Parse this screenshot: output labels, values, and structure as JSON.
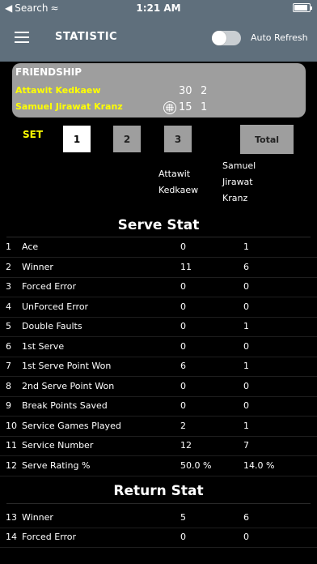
{
  "status": {
    "carrier": "Search",
    "time": "1:21 AM"
  },
  "nav": {
    "title": "STATISTIC",
    "auto_refresh_label": "Auto Refresh",
    "auto_refresh_on": false
  },
  "match": {
    "title": "FRIENDSHIP",
    "players": [
      {
        "name": "Attawit Kedkaew",
        "points": "30",
        "games": "2"
      },
      {
        "name": "Samuel Jirawat Kranz",
        "points": "15",
        "games": "1"
      }
    ]
  },
  "sets": {
    "label": "SET",
    "buttons": [
      "1",
      "2",
      "3"
    ],
    "total": "Total",
    "selected": "1"
  },
  "columns": {
    "player1": [
      "Attawit",
      "Kedkaew"
    ],
    "player2": [
      "Samuel",
      "Jirawat",
      "Kranz"
    ]
  },
  "serve_stat": {
    "title": "Serve Stat",
    "rows": [
      {
        "num": "1",
        "label": "Ace",
        "p1": "0",
        "p2": "1"
      },
      {
        "num": "2",
        "label": "Winner",
        "p1": "11",
        "p2": "6"
      },
      {
        "num": "3",
        "label": "Forced Error",
        "p1": "0",
        "p2": "0"
      },
      {
        "num": "4",
        "label": "UnForced Error",
        "p1": "0",
        "p2": "0"
      },
      {
        "num": "5",
        "label": "Double Faults",
        "p1": "0",
        "p2": "1"
      },
      {
        "num": "6",
        "label": "1st Serve",
        "p1": "0",
        "p2": "0"
      },
      {
        "num": "7",
        "label": "1st Serve Point Won",
        "p1": "6",
        "p2": "1"
      },
      {
        "num": "8",
        "label": "2nd Serve Point Won",
        "p1": "0",
        "p2": "0"
      },
      {
        "num": "9",
        "label": "Break Points Saved",
        "p1": "0",
        "p2": "0"
      },
      {
        "num": "10",
        "label": "Service Games Played",
        "p1": "2",
        "p2": "1"
      },
      {
        "num": "11",
        "label": "Service Number",
        "p1": "12",
        "p2": "7"
      },
      {
        "num": "12",
        "label": "Serve Rating %",
        "p1": "50.0 %",
        "p2": "14.0 %"
      }
    ]
  },
  "return_stat": {
    "title": "Return Stat",
    "rows": [
      {
        "num": "13",
        "label": "Winner",
        "p1": "5",
        "p2": "6"
      },
      {
        "num": "14",
        "label": "Forced Error",
        "p1": "0",
        "p2": "0"
      }
    ]
  }
}
